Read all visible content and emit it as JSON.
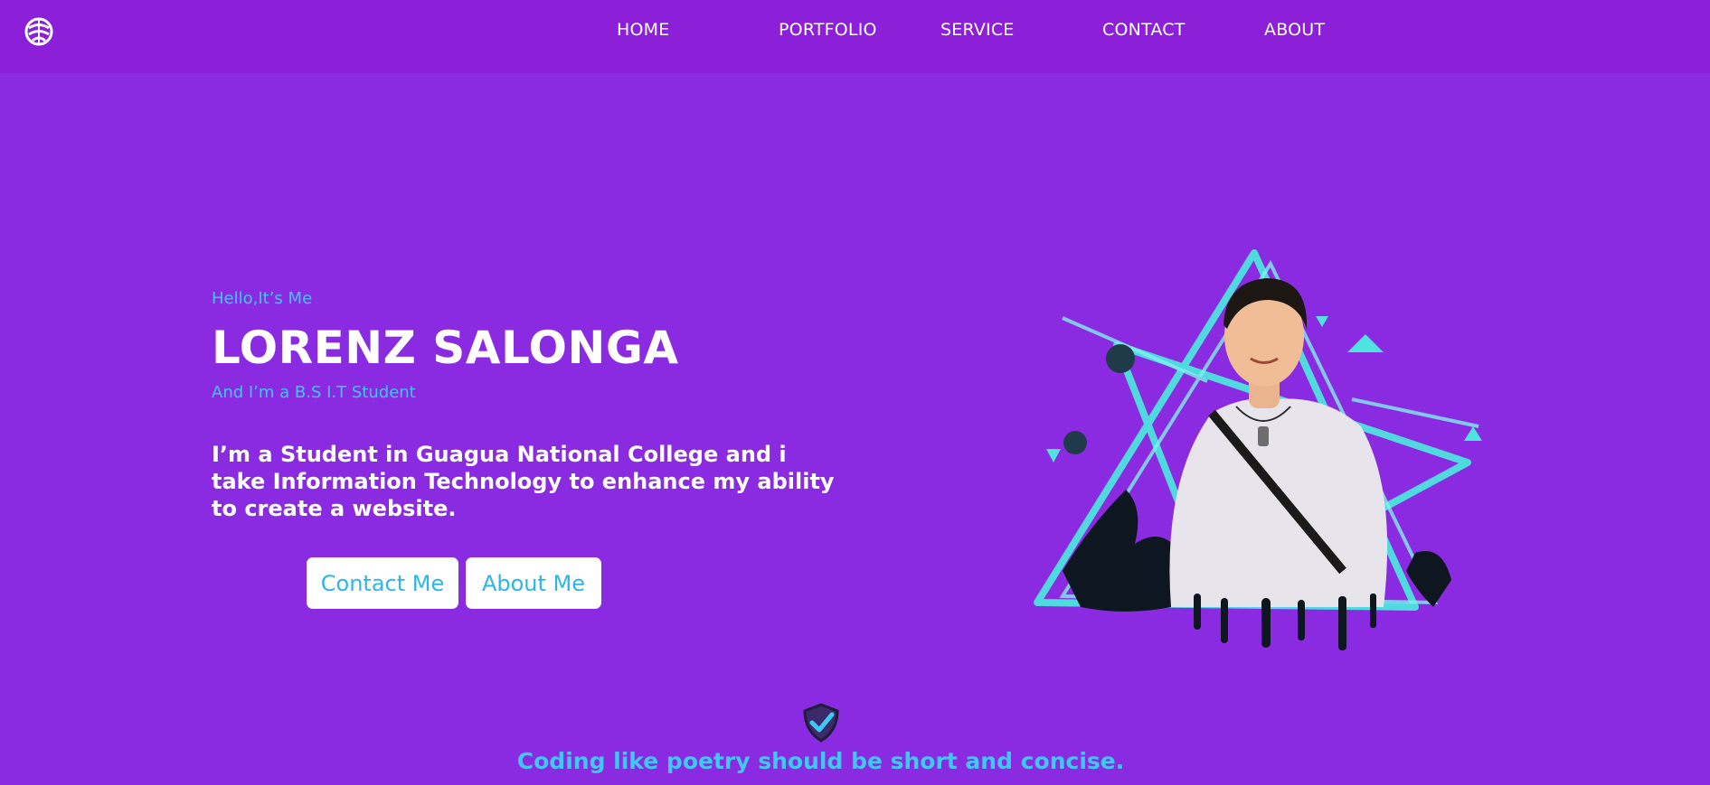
{
  "nav": {
    "logo_icon": "globe-leaf-logo-icon",
    "links": [
      {
        "label": "HOME"
      },
      {
        "label": "PORTFOLIO"
      },
      {
        "label": "SERVICE"
      },
      {
        "label": "CONTACT"
      },
      {
        "label": "ABOUT"
      }
    ]
  },
  "hero": {
    "greeting": "Hello,It’s Me",
    "name": "LORENZ SALONGA",
    "role": "And I’m a B.S I.T Student",
    "bio": "I’m a Student in Guagua National College and i take Information Technology to enhance my ability to create a website.",
    "buttons": {
      "contact": "Contact Me",
      "about": "About Me"
    },
    "portrait_alt": "portrait-with-neon-triangles"
  },
  "footer": {
    "shield_icon": "shield-check-icon",
    "quote": "Coding like poetry should be short and concise."
  },
  "colors": {
    "background": "#8a2be2",
    "navbar": "#8c1fd8",
    "accent": "#3ec8f2",
    "neon": "#4fe3e0"
  }
}
